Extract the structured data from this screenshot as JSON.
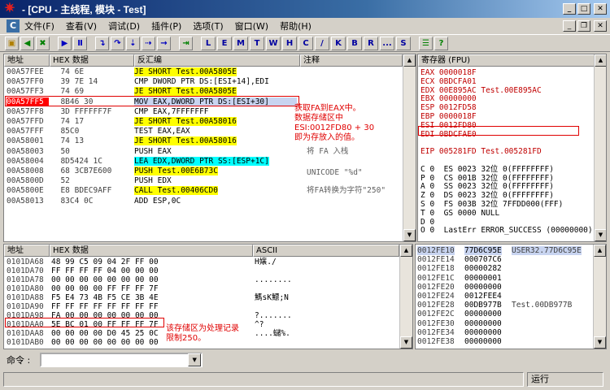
{
  "window": {
    "title": "- [CPU - 主线程, 模块 - Test]"
  },
  "menu": [
    "文件(F)",
    "查看(V)",
    "调试(D)",
    "插件(P)",
    "选项(T)",
    "窗口(W)",
    "帮助(H)"
  ],
  "toolbar_letters": [
    "L",
    "E",
    "M",
    "T",
    "W",
    "H",
    "C",
    "/",
    "K",
    "B",
    "R",
    "...",
    "S"
  ],
  "disasm": {
    "headers": {
      "address": "地址",
      "hex": "HEX 数据",
      "code": "反汇编",
      "comment": "注释"
    },
    "rows": [
      {
        "a": "00A57FEE",
        "h": "  74 6E",
        "c": "JE SHORT Test.00A5805E",
        "hl": "yellow"
      },
      {
        "a": "00A57FF0",
        "h": "  39 7E 14",
        "c": "CMP DWORD PTR DS:[ESI+14],EDI",
        "hl": ""
      },
      {
        "a": "00A57FF3",
        "h": "  74 69",
        "c": "JE SHORT Test.00A5805E",
        "hl": "yellow"
      },
      {
        "a": "00A57FF5",
        "h": "  8B46 30",
        "c": "MOV EAX,DWORD PTR DS:[ESI+30]",
        "hl": "sel"
      },
      {
        "a": "00A57FF8",
        "h": "  3D FFFFFF7F",
        "c": "CMP EAX,7FFFFFFF",
        "hl": ""
      },
      {
        "a": "00A57FFD",
        "h": "  74 17",
        "c": "JE SHORT Test.00A58016",
        "hl": "yellow"
      },
      {
        "a": "00A57FFF",
        "h": "  85C0",
        "c": "TEST EAX,EAX",
        "hl": ""
      },
      {
        "a": "00A58001",
        "h": "  74 13",
        "c": "JE SHORT Test.00A58016",
        "hl": "yellow"
      },
      {
        "a": "00A58003",
        "h": "  50",
        "c": "PUSH EAX",
        "hl": ""
      },
      {
        "a": "00A58004",
        "h": "  8D5424 1C",
        "c": "LEA EDX,DWORD PTR SS:[ESP+1C]",
        "hl": "cyan"
      },
      {
        "a": "00A58008",
        "h": "  68 3CB7E600",
        "c": "PUSH Test.00E6B73C",
        "hl": "yellow"
      },
      {
        "a": "00A5800D",
        "h": "  52",
        "c": "PUSH EDX",
        "hl": ""
      },
      {
        "a": "00A5800E",
        "h": "  E8 BDEC9AFF",
        "c": "CALL Test.00406CD0",
        "hl": "yellow"
      },
      {
        "a": "00A58013",
        "h": "  83C4 0C",
        "c": "ADD ESP,0C",
        "hl": ""
      }
    ],
    "comments": [
      "将 FA 入栈",
      "UNICODE \"%d\"",
      "将FA转换为字符\"250\""
    ],
    "annotation": "获取FA到EAX中。\n数据存储区中\nESI:0012FD80 + 30\n即为存放入的值。"
  },
  "registers": {
    "header": "寄存器 (FPU)",
    "rows": [
      "EAX 0000018F",
      "ECX 0BDCFA01",
      "EDX 00E895AC Test.00E895AC",
      "EBX 00000000",
      "ESP 0012FD58",
      "EBP 0000018F",
      "ESI 0012FD80",
      "EDI 0BDCFAE0",
      "",
      "EIP 005281FD Test.005281FD",
      "",
      "C 0  ES 0023 32位 0(FFFFFFFF)",
      "P 0  CS 001B 32位 0(FFFFFFFF)",
      "A 0  SS 0023 32位 0(FFFFFFFF)",
      "Z 0  DS 0023 32位 0(FFFFFFFF)",
      "S 0  FS 003B 32位 7FFDD000(FFF)",
      "T 0  GS 0000 NULL",
      "D 0",
      "O 0  LastErr ERROR_SUCCESS (00000000)"
    ]
  },
  "dump": {
    "headers": {
      "address": "地址",
      "hex": "HEX 数据",
      "ascii": "ASCII"
    },
    "rows": [
      {
        "a": "0101DA68",
        "h": "48 99 C5 09 04 2F FF 00",
        "s": "H嬢./"
      },
      {
        "a": "0101DA70",
        "h": "FF FF FF FF 04 00 00 00",
        "s": ""
      },
      {
        "a": "0101DA78",
        "h": "00 00 00 00 00 00 00 00",
        "s": "........"
      },
      {
        "a": "0101DA80",
        "h": "00 00 00 00 FF FF FF 7F",
        "s": ""
      },
      {
        "a": "0101DA88",
        "h": "F5 E4 73 4B F5 CE 3B 4E",
        "s": "鰢sK鰾;N"
      },
      {
        "a": "0101DA90",
        "h": "FF FF FF FF FF FF FF FF",
        "s": ""
      },
      {
        "a": "0101DA98",
        "h": "FA 00 00 00 00 00 00 00",
        "s": "?......."
      },
      {
        "a": "0101DAA0",
        "h": "5E BC 01 00 FF FF FF 7F",
        "s": "^?"
      },
      {
        "a": "0101DAA8",
        "h": "00 00 00 00 D0 45 25 0C",
        "s": "....蠩%."
      },
      {
        "a": "0101DAB0",
        "h": "00 00 00 00 00 00 00 00",
        "s": ""
      }
    ],
    "annotation": "该存储区为处理记录\n限制250。"
  },
  "stack": {
    "rows": [
      {
        "a": "0012FE10",
        "v": "77D6C95E",
        "c": "USER32.77D6C95E",
        "sel": true
      },
      {
        "a": "0012FE14",
        "v": "000707C6",
        "c": ""
      },
      {
        "a": "0012FE18",
        "v": "00000282",
        "c": ""
      },
      {
        "a": "0012FE1C",
        "v": "00000001",
        "c": ""
      },
      {
        "a": "0012FE20",
        "v": "00000000",
        "c": ""
      },
      {
        "a": "0012FE24",
        "v": "0012FEE4",
        "c": ""
      },
      {
        "a": "0012FE28",
        "v": "00DB977B",
        "c": "Test.00DB977B"
      },
      {
        "a": "0012FE2C",
        "v": "00000000",
        "c": ""
      },
      {
        "a": "0012FE30",
        "v": "00000000",
        "c": ""
      },
      {
        "a": "0012FE34",
        "v": "00000000",
        "c": ""
      },
      {
        "a": "0012FE38",
        "v": "00000000",
        "c": ""
      }
    ]
  },
  "command": {
    "label": "命令 :",
    "value": ""
  },
  "status": {
    "state": "运行"
  }
}
